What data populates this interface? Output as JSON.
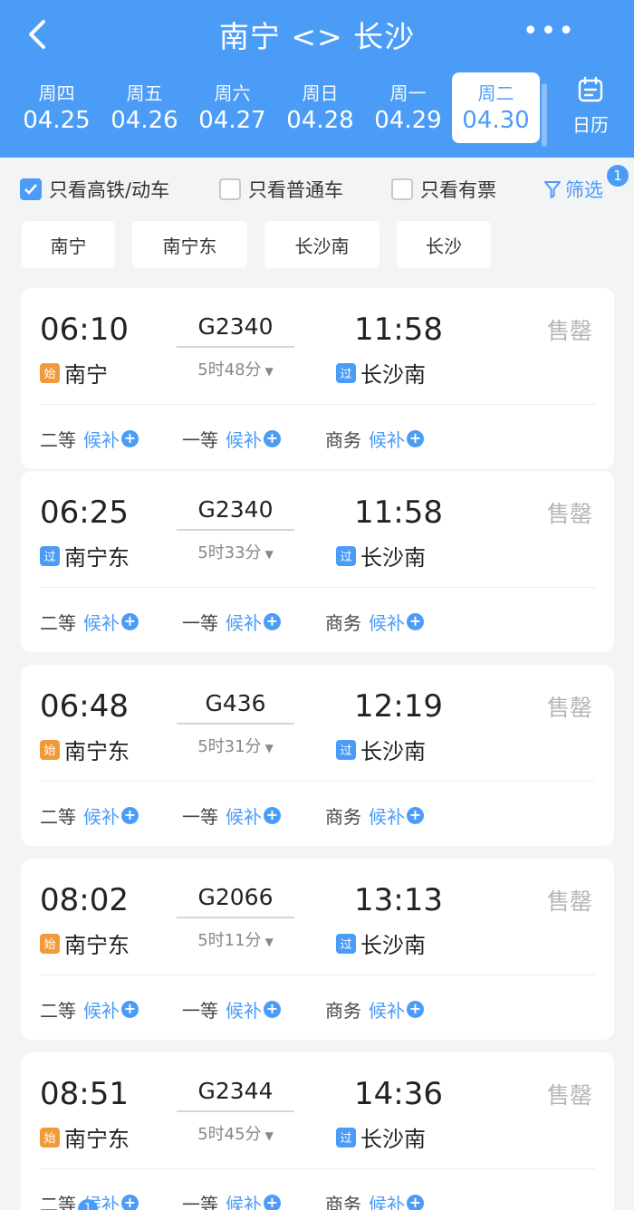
{
  "header": {
    "title": "南宁 <> 长沙",
    "more_label": "•••",
    "calendar_label": "日历"
  },
  "dates": [
    {
      "weekday": "周四",
      "date": "04.25"
    },
    {
      "weekday": "周五",
      "date": "04.26"
    },
    {
      "weekday": "周六",
      "date": "04.27"
    },
    {
      "weekday": "周日",
      "date": "04.28"
    },
    {
      "weekday": "周一",
      "date": "04.29"
    },
    {
      "weekday": "周二",
      "date": "04.30",
      "selected": true
    }
  ],
  "filters": {
    "hs_only": "只看高铁/动车",
    "normal_only": "只看普通车",
    "tickets_only": "只看有票",
    "filter_label": "筛选",
    "filter_badge": "1"
  },
  "stations": [
    "南宁",
    "南宁东",
    "长沙南",
    "长沙"
  ],
  "tags": {
    "start": "始",
    "pass": "过"
  },
  "seat_labels": {
    "second": "二等",
    "first": "一等",
    "business": "商务",
    "waitlist": "候补"
  },
  "trains": [
    {
      "dep_time": "06:10",
      "train_no": "G2340",
      "arr_time": "11:58",
      "duration": "5时48分",
      "from": "南宁",
      "from_tag": "start",
      "to": "长沙南",
      "to_tag": "pass",
      "status": "售罄"
    },
    {
      "dep_time": "06:25",
      "train_no": "G2340",
      "arr_time": "11:58",
      "duration": "5时33分",
      "from": "南宁东",
      "from_tag": "pass",
      "to": "长沙南",
      "to_tag": "pass",
      "status": "售罄"
    },
    {
      "dep_time": "06:48",
      "train_no": "G436",
      "arr_time": "12:19",
      "duration": "5时31分",
      "from": "南宁东",
      "from_tag": "start",
      "to": "长沙南",
      "to_tag": "pass",
      "status": "售罄"
    },
    {
      "dep_time": "08:02",
      "train_no": "G2066",
      "arr_time": "13:13",
      "duration": "5时11分",
      "from": "南宁东",
      "from_tag": "start",
      "to": "长沙南",
      "to_tag": "pass",
      "status": "售罄"
    },
    {
      "dep_time": "08:51",
      "train_no": "G2344",
      "arr_time": "14:36",
      "duration": "5时45分",
      "from": "南宁东",
      "from_tag": "start",
      "to": "长沙南",
      "to_tag": "pass",
      "status": "售罄"
    }
  ],
  "bottom_badge": "1",
  "colors": {
    "primary": "#4b9cf7",
    "start_tag": "#f19a39",
    "sold_out": "#b5b5b5"
  }
}
